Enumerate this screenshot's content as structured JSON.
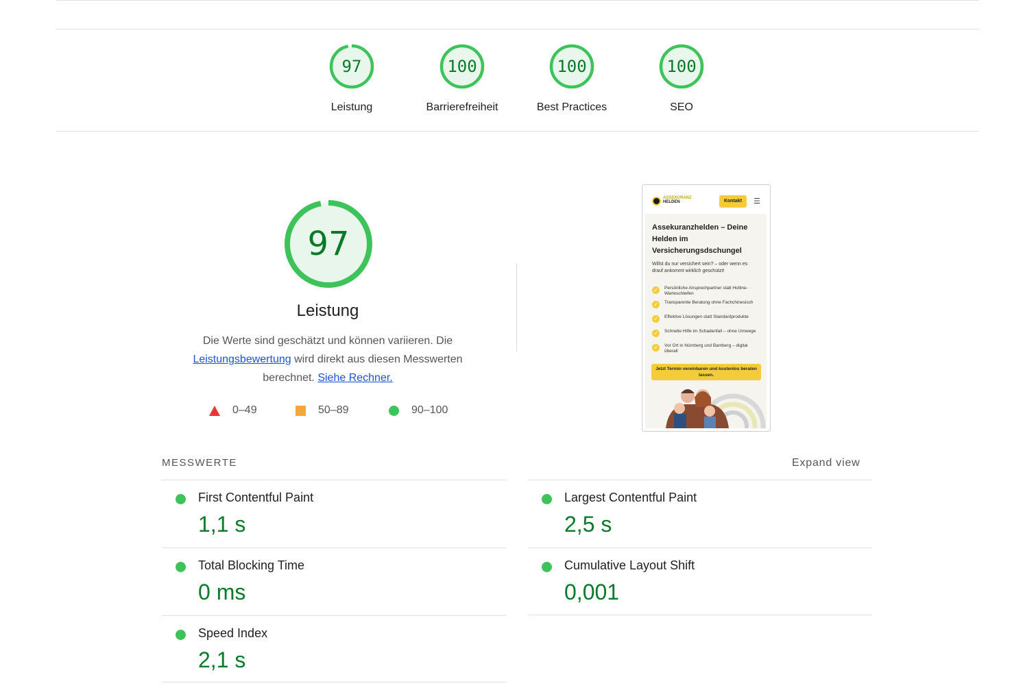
{
  "gauges": [
    {
      "score": "97",
      "value": 97,
      "label": "Leistung"
    },
    {
      "score": "100",
      "value": 100,
      "label": "Barrierefreiheit"
    },
    {
      "score": "100",
      "value": 100,
      "label": "Best Practices"
    },
    {
      "score": "100",
      "value": 100,
      "label": "SEO"
    }
  ],
  "performance": {
    "score": "97",
    "value": 97,
    "title": "Leistung",
    "desc_part1": "Die Werte sind geschätzt und können variieren. Die",
    "desc_link1": "Leistungsbewertung",
    "desc_part2": "wird direkt aus diesen Messwerten berechnet.",
    "desc_link2": "Siehe Rechner.",
    "legend": [
      {
        "shape": "triangle-icon",
        "range": "0–49",
        "color": "#e53935"
      },
      {
        "shape": "square-icon",
        "range": "50–89",
        "color": "#f4a73c"
      },
      {
        "shape": "circle-icon",
        "range": "90–100",
        "color": "#3ec35a"
      }
    ]
  },
  "screenshot": {
    "brand_line1": "ASSEKURANZ",
    "brand_line2": "HELDEN",
    "contact_button": "Kontakt",
    "headline": "Assekuranzhelden – Deine Helden im Versicherungsdschungel",
    "subline": "Willst du nur versichert sein? – oder wenn es drauf ankommt wirklich geschützt!",
    "items": [
      "Persönliche Ansprechpartner statt Hotline-Warteschleifen",
      "Transparente Beratung ohne Fachchinesisch",
      "Effektive Lösungen statt Standardprodukte",
      "Schnelle Hilfe im Schadenfall – ohne Umwege",
      "Vor Ort in Nürnberg und Bamberg – digital überall"
    ],
    "cta": "Jetzt Termin vereinbaren und kostenlos beraten lassen."
  },
  "metrics": {
    "heading": "MESSWERTE",
    "expand": "Expand view",
    "items": [
      {
        "name": "First Contentful Paint",
        "value": "1,1 s"
      },
      {
        "name": "Largest Contentful Paint",
        "value": "2,5 s"
      },
      {
        "name": "Total Blocking Time",
        "value": "0 ms"
      },
      {
        "name": "Cumulative Layout Shift",
        "value": "0,001"
      },
      {
        "name": "Speed Index",
        "value": "2,1 s"
      }
    ]
  },
  "colors": {
    "pass_green": "#0a7a2a",
    "pass_dot": "#3ec35a",
    "gauge_fill": "#e8f6eb",
    "gauge_ring": "#3ec35a",
    "link": "#1a55d6",
    "accent_yellow": "#f4cc3a"
  }
}
